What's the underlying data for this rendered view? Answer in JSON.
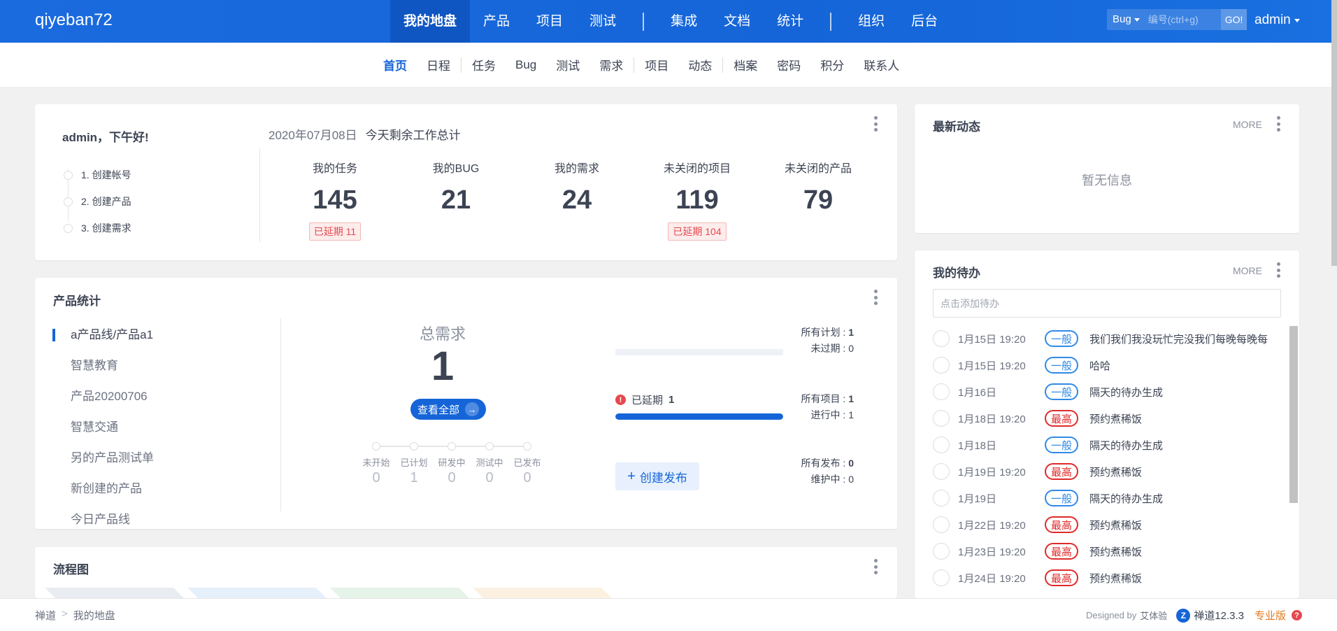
{
  "header": {
    "brand": "qiyeban72",
    "nav": [
      "我的地盘",
      "产品",
      "项目",
      "测试",
      "集成",
      "文档",
      "统计",
      "组织",
      "后台"
    ],
    "search_type": "Bug",
    "search_placeholder": "编号(ctrl+g)",
    "search_go": "GO!",
    "user": "admin"
  },
  "subnav": [
    "首页",
    "日程",
    "任务",
    "Bug",
    "测试",
    "需求",
    "项目",
    "动态",
    "档案",
    "密码",
    "积分",
    "联系人"
  ],
  "welcome": {
    "greeting": "admin，下午好!",
    "date": "2020年07月08日",
    "summary_label": "今天剩余工作总计",
    "steps": [
      "1. 创建帐号",
      "2. 创建产品",
      "3. 创建需求"
    ],
    "stats": [
      {
        "label": "我的任务",
        "value": "145",
        "badge": "已延期 11"
      },
      {
        "label": "我的BUG",
        "value": "21",
        "badge": ""
      },
      {
        "label": "我的需求",
        "value": "24",
        "badge": ""
      },
      {
        "label": "未关闭的项目",
        "value": "119",
        "badge": "已延期 104"
      },
      {
        "label": "未关闭的产品",
        "value": "79",
        "badge": ""
      }
    ]
  },
  "product_stats": {
    "title": "产品统计",
    "products": [
      "a产品线/产品a1",
      "智慧教育",
      "产品20200706",
      "智慧交通",
      "另的产品测试单",
      "新创建的产品",
      "今日产品线"
    ],
    "total_label": "总需求",
    "total_value": "1",
    "view_all": "查看全部",
    "flow": [
      {
        "label": "未开始",
        "value": "0"
      },
      {
        "label": "已计划",
        "value": "1"
      },
      {
        "label": "研发中",
        "value": "0"
      },
      {
        "label": "测试中",
        "value": "0"
      },
      {
        "label": "已发布",
        "value": "0"
      }
    ],
    "overdue_label": "已延期",
    "overdue_value": "1",
    "project_progress": 1.0,
    "create_release": "创建发布",
    "plans": {
      "all_label": "所有计划 : ",
      "all_value": "1",
      "unexpired_label": "未过期 : ",
      "unexpired_value": "0"
    },
    "projects": {
      "all_label": "所有项目 : ",
      "all_value": "1",
      "active_label": "进行中 : ",
      "active_value": "1"
    },
    "releases": {
      "all_label": "所有发布 : ",
      "all_value": "0",
      "maintain_label": "维护中 : ",
      "maintain_value": "0"
    }
  },
  "flowchart": {
    "title": "流程图",
    "tag_colors": [
      "#e9edf2",
      "#e5f0fb",
      "#e6f3e8",
      "#fcf1e1"
    ]
  },
  "latest": {
    "title": "最新动态",
    "more": "MORE",
    "empty": "暂无信息"
  },
  "todo": {
    "title": "我的待办",
    "more": "MORE",
    "placeholder": "点击添加待办",
    "items": [
      {
        "time": "1月15日 19:20",
        "priority": "一般",
        "level": "normal",
        "text": "我们我们我没玩忙完没我们每晚每晚每"
      },
      {
        "time": "1月15日 19:20",
        "priority": "一般",
        "level": "normal",
        "text": "哈哈"
      },
      {
        "time": "1月16日",
        "priority": "一般",
        "level": "normal",
        "text": "隔天的待办生成"
      },
      {
        "time": "1月18日 19:20",
        "priority": "最高",
        "level": "high",
        "text": "预约煮稀饭"
      },
      {
        "time": "1月18日",
        "priority": "一般",
        "level": "normal",
        "text": "隔天的待办生成"
      },
      {
        "time": "1月19日 19:20",
        "priority": "最高",
        "level": "high",
        "text": "预约煮稀饭"
      },
      {
        "time": "1月19日",
        "priority": "一般",
        "level": "normal",
        "text": "隔天的待办生成"
      },
      {
        "time": "1月22日 19:20",
        "priority": "最高",
        "level": "high",
        "text": "预约煮稀饭"
      },
      {
        "time": "1月23日 19:20",
        "priority": "最高",
        "level": "high",
        "text": "预约煮稀饭"
      },
      {
        "time": "1月24日 19:20",
        "priority": "最高",
        "level": "high",
        "text": "预约煮稀饭"
      }
    ]
  },
  "footer": {
    "breadcrumb": [
      "禅道",
      "我的地盘"
    ],
    "designed_by": "Designed by",
    "designer": "艾体验",
    "version": "禅道12.3.3",
    "edition": "专业版"
  },
  "colors": {
    "primary": "#1565d8",
    "danger": "#e5484d",
    "normal_priority": "#2f8ae6",
    "high_priority": "#e02a2a"
  }
}
